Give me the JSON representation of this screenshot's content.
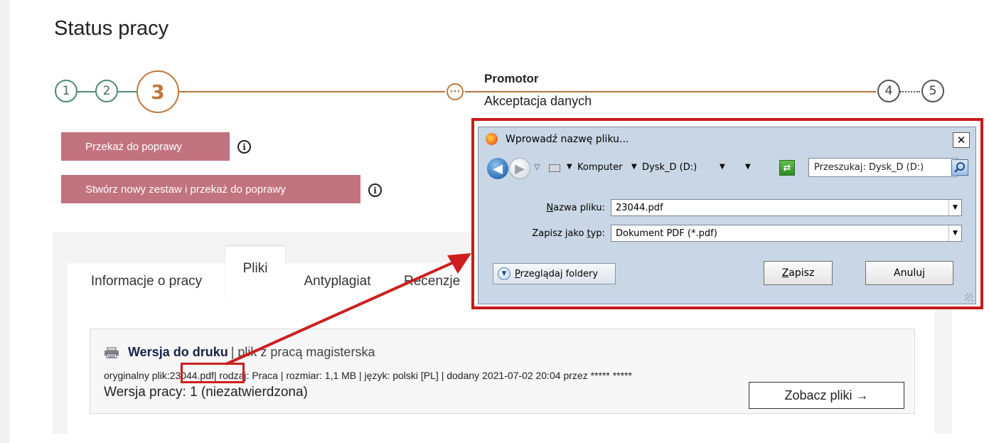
{
  "page": {
    "title": "Status pracy"
  },
  "stepper": {
    "steps": [
      "1",
      "2",
      "3",
      "4",
      "5"
    ],
    "current_step": "3",
    "current_marker": "···",
    "current_title": "Promotor",
    "current_subtitle": "Akceptacja danych",
    "colors": {
      "done": "#4f8a73",
      "current": "#c0783c",
      "pending": "#555555"
    }
  },
  "actions": {
    "return_label": "Przekaż do poprawy",
    "new_set_label": "Stwórz nowy zestaw i przekaż do poprawy",
    "info_glyph": "i",
    "button_color": "#c17380"
  },
  "tabs": [
    {
      "label": "Informacje o pracy",
      "active": false
    },
    {
      "label": "Pliki",
      "active": true
    },
    {
      "label": "Antyplagiat",
      "active": false
    },
    {
      "label": "Recenzje",
      "active": false
    }
  ],
  "file": {
    "title": "Wersja do druku",
    "separator": "| plik z pracą magisterska",
    "meta_prefix": "oryginalny plik:",
    "filename": "23044.pdf",
    "meta_rest": "| rodzaj: Praca | rozmiar: 1,1 MB | język: polski [PL] | dodany 2021-07-02 20:04 przez ***** *****",
    "version": "Wersja pracy: 1 (niezatwierdzona)",
    "view_button": "Zobacz pliki →",
    "icon": "printer-icon"
  },
  "dialog": {
    "title": "Wprowadź nazwę pliku...",
    "close_glyph": "✕",
    "breadcrumb": [
      "Komputer",
      "Dysk_D (D:)"
    ],
    "search_placeholder": "Przeszukaj: Dysk_D (D:)",
    "filename_label": {
      "pre": "",
      "accel": "N",
      "post": "azwa pliku:"
    },
    "filename_value": "23044.pdf",
    "type_label": {
      "pre": "Zapisz jako ",
      "accel": "t",
      "post": "yp:"
    },
    "type_value": "Dokument PDF (*.pdf)",
    "browse_label": {
      "pre": "",
      "accel": "P",
      "post": "rzeglądaj foldery"
    },
    "save_label": {
      "pre": "",
      "accel": "Z",
      "post": "apisz"
    },
    "cancel_label": "Anuluj",
    "highlight_color": "#c91a1a"
  }
}
